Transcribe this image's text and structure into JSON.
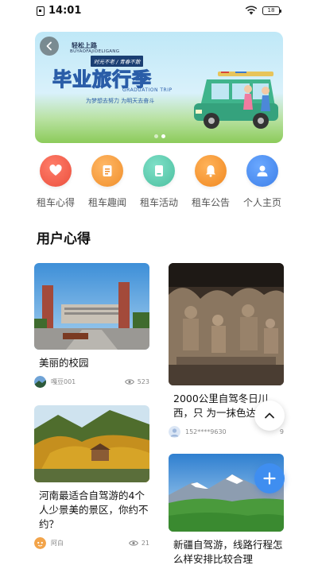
{
  "status_bar": {
    "time": "14:01",
    "battery": "18"
  },
  "banner": {
    "brand": "轻松上路",
    "brand_en": "BUYAOFAJIDELIGANG",
    "slogan": "时光不老 / 青春不散",
    "title": "毕业旅行季",
    "subtitle": "GRADUATION TRIP",
    "tagline": "为梦想去努力 为明天去奋斗",
    "slide_count": 2,
    "active_slide": 1
  },
  "categories": [
    {
      "label": "租车心得",
      "icon": "heart-icon",
      "color": "#f0644f"
    },
    {
      "label": "租车趣闻",
      "icon": "document-icon",
      "color": "#f5a142"
    },
    {
      "label": "租车活动",
      "icon": "memo-icon",
      "color": "#5cc9b0"
    },
    {
      "label": "租车公告",
      "icon": "bell-icon",
      "color": "#f59a2a"
    },
    {
      "label": "个人主页",
      "icon": "person-icon",
      "color": "#4f8ef2"
    }
  ],
  "section": {
    "title": "用户心得"
  },
  "posts": [
    {
      "title": "美丽的校园",
      "author": "嘎豆001",
      "views": "523"
    },
    {
      "title": "2000公里自驾冬日川西，只 为一抹色达",
      "author": "152****9630",
      "views": "9"
    },
    {
      "title": "河南最适合自驾游的4个人少景美的景区，你约不约？",
      "author": "阿白",
      "views": "21"
    },
    {
      "title": "新疆自驾游，线路行程怎么样安排比较合理",
      "author": "",
      "views": ""
    }
  ],
  "colors": {
    "accent": "#3f8ef0",
    "title_text": "#111111",
    "meta_text": "#888888"
  }
}
